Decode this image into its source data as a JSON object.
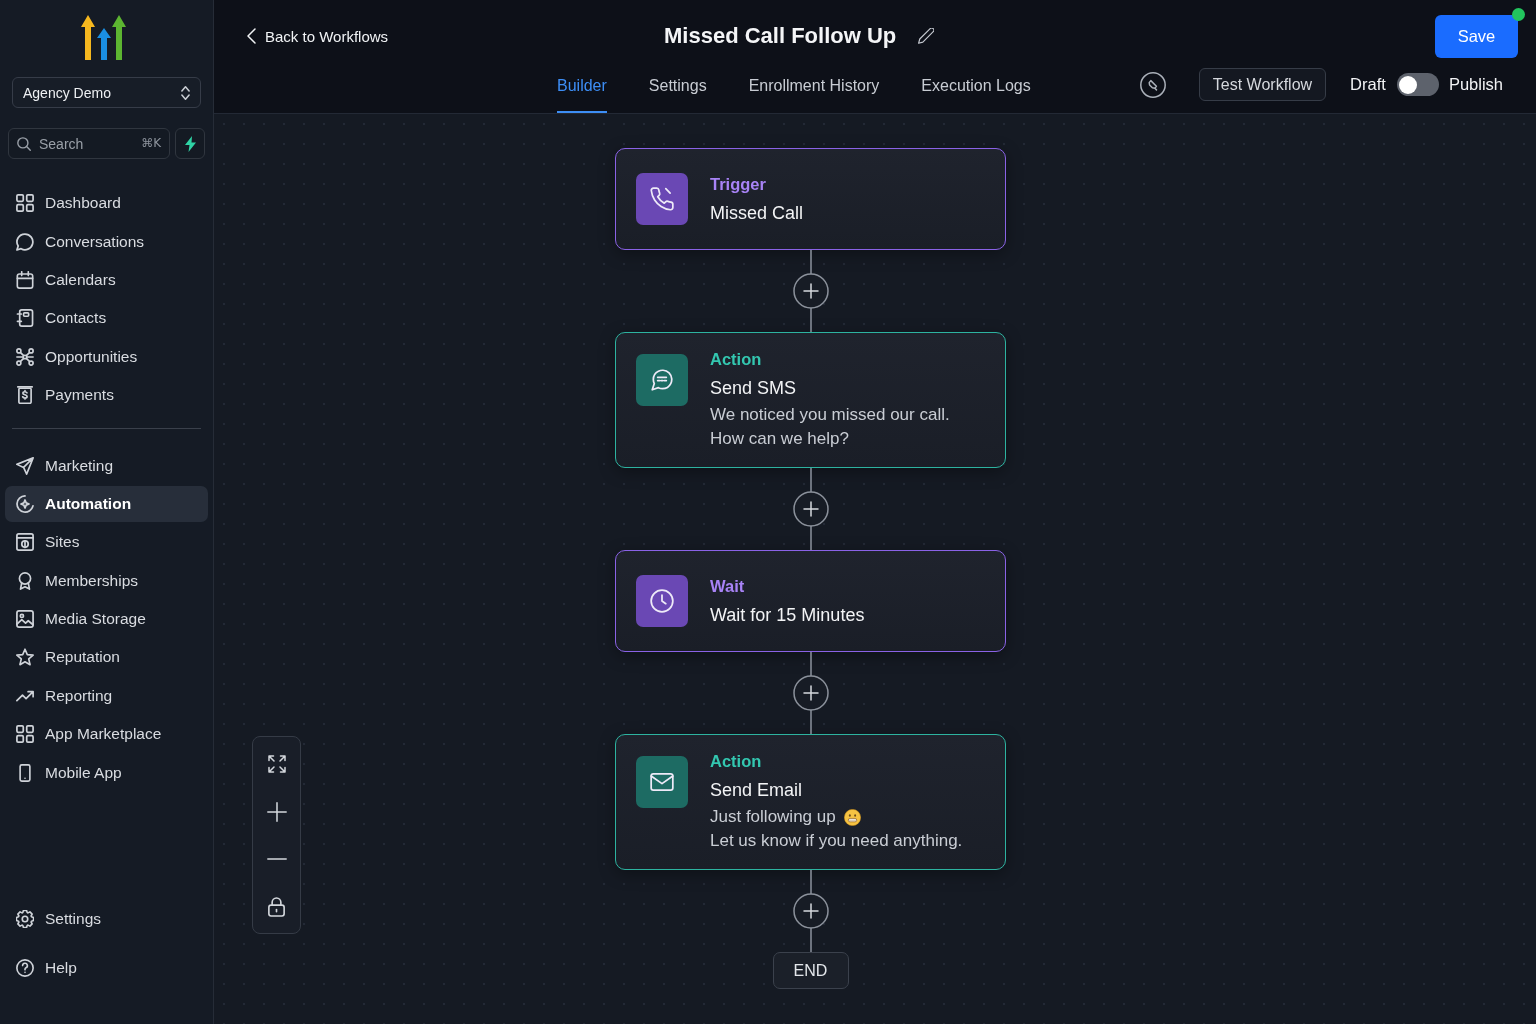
{
  "sidebar": {
    "account": "Agency Demo",
    "search": {
      "placeholder": "Search",
      "shortcut": "⌘K"
    },
    "nav_primary": [
      {
        "label": "Dashboard",
        "selected": false
      },
      {
        "label": "Conversations",
        "selected": false
      },
      {
        "label": "Calendars",
        "selected": false
      },
      {
        "label": "Contacts",
        "selected": false
      },
      {
        "label": "Opportunities",
        "selected": false
      },
      {
        "label": "Payments",
        "selected": false
      }
    ],
    "nav_secondary": [
      {
        "label": "Marketing",
        "selected": false
      },
      {
        "label": "Automation",
        "selected": true
      },
      {
        "label": "Sites",
        "selected": false
      },
      {
        "label": "Memberships",
        "selected": false
      },
      {
        "label": "Media Storage",
        "selected": false
      },
      {
        "label": "Reputation",
        "selected": false
      },
      {
        "label": "Reporting",
        "selected": false
      },
      {
        "label": "App Marketplace",
        "selected": false
      },
      {
        "label": "Mobile App",
        "selected": false
      }
    ],
    "nav_footer": [
      {
        "label": "Settings",
        "selected": false
      },
      {
        "label": "Help",
        "selected": false
      }
    ]
  },
  "header": {
    "back_link": "Back to Workflows",
    "title": "Missed Call Follow Up",
    "save_button": "Save",
    "tabs": [
      {
        "label": "Builder",
        "selected": true
      },
      {
        "label": "Settings",
        "selected": false
      },
      {
        "label": "Enrollment History",
        "selected": false
      },
      {
        "label": "Execution Logs",
        "selected": false
      }
    ],
    "test_button": "Test Workflow",
    "publish_toggle": {
      "off_label": "Draft",
      "on_label": "Publish",
      "on": false
    }
  },
  "canvas": {
    "steps": [
      {
        "kind": "trigger",
        "type_label": "Trigger",
        "title": "Missed Call"
      },
      {
        "kind": "sms",
        "type_label": "Action",
        "title": "Send SMS",
        "message": [
          "We noticed you missed our call.",
          "How can we help?"
        ]
      },
      {
        "kind": "wait",
        "type_label": "Wait",
        "title": "Wait for 15 Minutes"
      },
      {
        "kind": "email",
        "type_label": "Action",
        "title": "Send Email",
        "message": [
          "Just following up",
          "Let us know if you need anything."
        ]
      }
    ],
    "end_label": "END"
  }
}
